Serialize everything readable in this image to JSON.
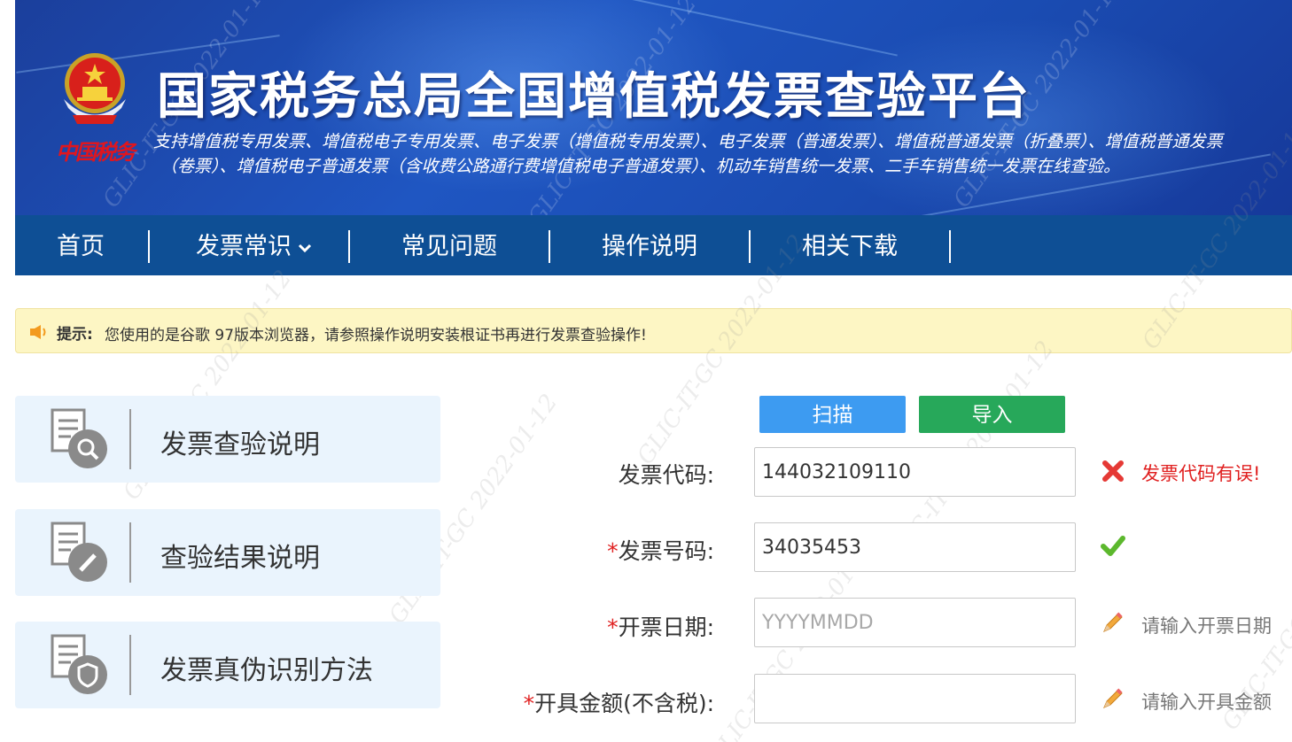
{
  "header": {
    "logo_text": "中国税务",
    "title": "国家税务总局全国增值税发票查验平台",
    "subtitle_line1": "支持增值税专用发票、增值税电子专用发票、电子发票（增值税专用发票）、电子发票（普通发票）、增值税普通发票（折叠票）、增值税普通发票",
    "subtitle_line2": "（卷票）、增值税电子普通发票（含收费公路通行费增值税电子普通发票）、机动车销售统一发票、二手车销售统一发票在线查验。"
  },
  "nav": {
    "items": [
      {
        "label": "首页"
      },
      {
        "label": "发票常识"
      },
      {
        "label": "常见问题"
      },
      {
        "label": "操作说明"
      },
      {
        "label": "相关下载"
      }
    ]
  },
  "notice": {
    "label": "提示:",
    "message": "您使用的是谷歌 97版本浏览器，请参照操作说明安装根证书再进行发票查验操作!"
  },
  "sidebar": {
    "cards": [
      {
        "label": "发票查验说明",
        "icon": "document-search-icon"
      },
      {
        "label": "查验结果说明",
        "icon": "document-edit-icon"
      },
      {
        "label": "发票真伪识别方法",
        "icon": "document-shield-icon"
      }
    ]
  },
  "form": {
    "scan_label": "扫描",
    "import_label": "导入",
    "fields": [
      {
        "required": "",
        "label": "发票代码:",
        "value": "144032109110",
        "placeholder": "",
        "status": "error",
        "message": "发票代码有误!"
      },
      {
        "required": "*",
        "label": "发票号码:",
        "value": "34035453",
        "placeholder": "",
        "status": "ok",
        "message": ""
      },
      {
        "required": "*",
        "label": "开票日期:",
        "value": "",
        "placeholder": "YYYYMMDD",
        "status": "hint",
        "message": "请输入开票日期"
      },
      {
        "required": "*",
        "label": "开具金额(不含税):",
        "value": "",
        "placeholder": "",
        "status": "hint",
        "message": "请输入开具金额"
      }
    ]
  },
  "watermark": "GLIC-IT-GC 2022-01-12",
  "colors": {
    "nav_bg": "#0e4f95",
    "scan_button": "#3d9bf1",
    "import_button": "#27a85a",
    "error_text": "#e02020",
    "notice_bg": "#fdf6c4",
    "card_bg": "#eaf4fd"
  }
}
